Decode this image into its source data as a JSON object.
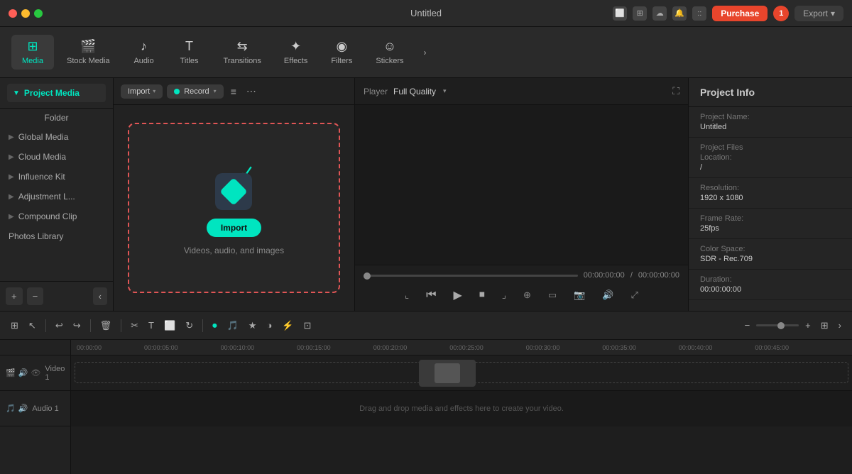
{
  "titlebar": {
    "title": "Untitled",
    "purchase_label": "Purchase",
    "export_label": "Export",
    "user_count": "1"
  },
  "toolbar": {
    "items": [
      {
        "id": "media",
        "label": "Media",
        "icon": "⊞",
        "active": true
      },
      {
        "id": "stock-media",
        "label": "Stock Media",
        "icon": "🎬"
      },
      {
        "id": "audio",
        "label": "Audio",
        "icon": "♪"
      },
      {
        "id": "titles",
        "label": "Titles",
        "icon": "T"
      },
      {
        "id": "transitions",
        "label": "Transitions",
        "icon": "⇆"
      },
      {
        "id": "effects",
        "label": "Effects",
        "icon": "✦"
      },
      {
        "id": "filters",
        "label": "Filters",
        "icon": "◉"
      },
      {
        "id": "stickers",
        "label": "Stickers",
        "icon": "☺"
      }
    ],
    "more_icon": "›"
  },
  "left_panel": {
    "title": "Project Media",
    "folder_label": "Folder",
    "items": [
      {
        "label": "Global Media"
      },
      {
        "label": "Cloud Media"
      },
      {
        "label": "Influence Kit"
      },
      {
        "label": "Adjustment L..."
      },
      {
        "label": "Compound Clip"
      },
      {
        "label": "Photos Library"
      }
    ]
  },
  "media_panel": {
    "import_label": "Import",
    "record_label": "Record",
    "filter_icon": "≡",
    "more_icon": "⋯",
    "import_button": "Import",
    "import_desc": "Videos, audio, and images"
  },
  "player": {
    "label": "Player",
    "quality": "Full Quality",
    "time_current": "00:00:00:00",
    "time_total": "00:00:00:00",
    "expand_icon": "⛶"
  },
  "right_panel": {
    "title": "Project Info",
    "fields": [
      {
        "label": "Project Name:",
        "value": "Untitled"
      },
      {
        "label": "Project Files",
        "value": "/"
      },
      {
        "label": "Location:"
      },
      {
        "label": "Resolution:",
        "value": "1920 x 1080"
      },
      {
        "label": "Frame Rate:",
        "value": "25fps"
      },
      {
        "label": "Color Space:",
        "value": "SDR - Rec.709"
      },
      {
        "label": "Duration:",
        "value": "00:00:00:00"
      }
    ]
  },
  "timeline": {
    "ruler_marks": [
      "00:00:00",
      "00:00:05:00",
      "00:00:10:00",
      "00:00:15:00",
      "00:00:20:00",
      "00:00:25:00",
      "00:00:30:00",
      "00:00:35:00",
      "00:00:40:00",
      "00:00:45:00"
    ],
    "tracks": [
      {
        "label": "Video 1",
        "type": "video"
      },
      {
        "label": "Audio 1",
        "type": "audio"
      }
    ],
    "drop_text": "Drag and drop media and effects here to create your video."
  }
}
